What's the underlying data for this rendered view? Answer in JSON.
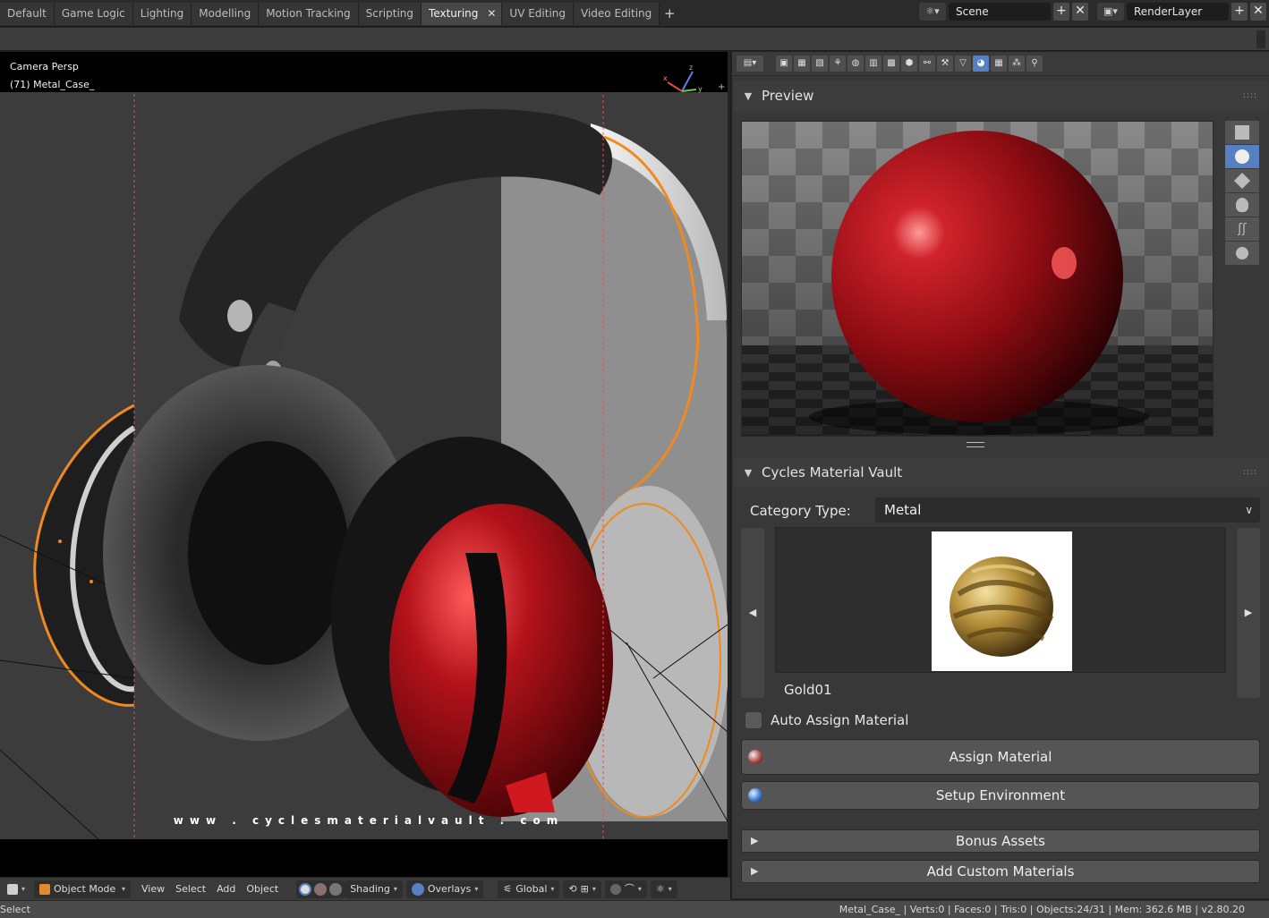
{
  "workspace_tabs": [
    "Default",
    "Game Logic",
    "Lighting",
    "Modelling",
    "Motion Tracking",
    "Scripting",
    "Texturing",
    "UV Editing",
    "Video Editing"
  ],
  "active_tab": "Texturing",
  "scene": {
    "name": "Scene",
    "render_layer": "RenderLayer"
  },
  "viewport": {
    "view_label": "Camera Persp",
    "object_label": "(71) Metal_Case_",
    "watermark": "www . cyclesmaterialvault . com",
    "axis_x": "x",
    "axis_y": "y",
    "axis_z": "z"
  },
  "viewport_header": {
    "mode": "Object Mode",
    "menu_view": "View",
    "menu_select": "Select",
    "menu_add": "Add",
    "menu_object": "Object",
    "shading": "Shading",
    "overlays": "Overlays",
    "orientation": "Global"
  },
  "properties": {
    "preview_title": "Preview",
    "addon_title": "Cycles Material Vault",
    "category_label": "Category Type:",
    "category_value": "Metal",
    "material_name": "Gold01",
    "auto_assign_label": "Auto Assign Material",
    "auto_assign_checked": false,
    "assign_button": "Assign Material",
    "setup_env_button": "Setup Environment",
    "bonus_assets": "Bonus Assets",
    "add_custom": "Add Custom Materials"
  },
  "status": {
    "left": "Select",
    "right": "Metal_Case_ | Verts:0 | Faces:0 | Tris:0 | Objects:24/31 | Mem: 362.6 MB | v2.80.20"
  },
  "colors": {
    "accent_blue": "#5680c2",
    "selection_orange": "#f08a1e",
    "material_red": "#a30d12"
  }
}
